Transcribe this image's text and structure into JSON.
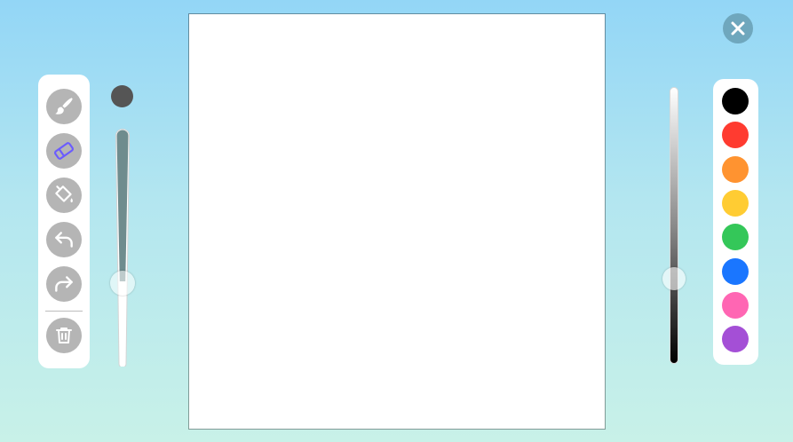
{
  "tools": [
    {
      "id": "brush",
      "icon": "brush-icon",
      "selected": false
    },
    {
      "id": "eraser",
      "icon": "eraser-icon",
      "selected": true
    },
    {
      "id": "fill",
      "icon": "paint-bucket-icon",
      "selected": false
    },
    {
      "id": "undo",
      "icon": "undo-icon",
      "selected": false
    },
    {
      "id": "redo",
      "icon": "redo-icon",
      "selected": false
    },
    {
      "id": "clear",
      "icon": "trash-icon",
      "selected": false
    }
  ],
  "brush_size": {
    "preview_color": "#555555",
    "level": 0.36
  },
  "shade": {
    "level": 0.69
  },
  "palette": [
    {
      "name": "black",
      "color": "#000000"
    },
    {
      "name": "red",
      "color": "#ff3b30"
    },
    {
      "name": "orange",
      "color": "#ff9330"
    },
    {
      "name": "yellow",
      "color": "#ffcc33"
    },
    {
      "name": "green",
      "color": "#34c759"
    },
    {
      "name": "blue",
      "color": "#1a76ff"
    },
    {
      "name": "pink",
      "color": "#ff66b3"
    },
    {
      "name": "purple",
      "color": "#a44fd6"
    }
  ],
  "colors": {
    "accent": "#6b5cff",
    "tool_bg": "#b5b5b5",
    "canvas": "#ffffff"
  }
}
